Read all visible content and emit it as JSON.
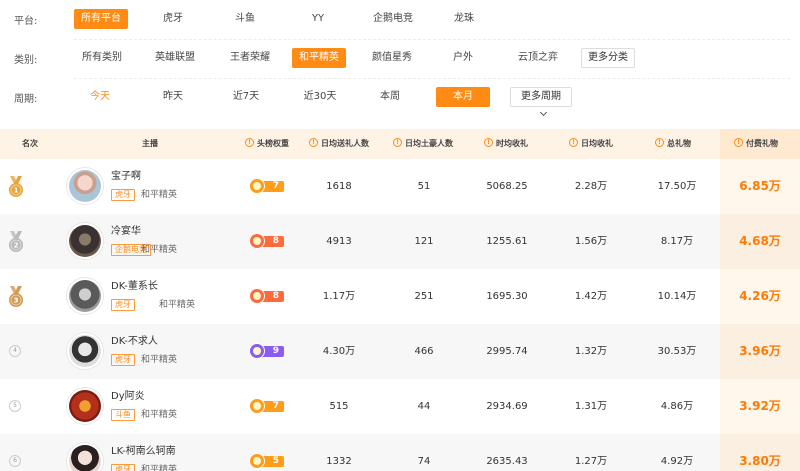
{
  "filters": {
    "platform": {
      "label": "平台:",
      "options": [
        "所有平台",
        "虎牙",
        "斗鱼",
        "YY",
        "企鹅电竞",
        "龙珠"
      ]
    },
    "category": {
      "label": "类别:",
      "options": [
        "所有类别",
        "英雄联盟",
        "王者荣耀",
        "和平精英",
        "颜值星秀",
        "户外",
        "云顶之弈"
      ],
      "more": "更多分类"
    },
    "period": {
      "label": "周期:",
      "options": [
        "今天",
        "昨天",
        "近7天",
        "近30天",
        "本周",
        "本月"
      ],
      "more": "更多周期"
    }
  },
  "table": {
    "headers": {
      "rank": "名次",
      "streamer": "主播",
      "weight": "头榜权重",
      "gifters": "日均送礼人数",
      "donors": "日均土豪人数",
      "hourly": "时均收礼",
      "daily": "日均收礼",
      "total": "总礼物",
      "paid": "付费礼物"
    },
    "rows": [
      {
        "rank": "1",
        "name": "宝子啊",
        "platform": "虎牙",
        "game": "和平精英",
        "level": "7",
        "gifters": "1618",
        "donors": "51",
        "hourly": "5068.25",
        "daily": "2.28万",
        "total": "17.50万",
        "paid": "6.85万"
      },
      {
        "rank": "2",
        "name": "冷宴华",
        "platform": "企鹅电竞",
        "game": "和平精英",
        "level": "8",
        "gifters": "4913",
        "donors": "121",
        "hourly": "1255.61",
        "daily": "1.56万",
        "total": "8.17万",
        "paid": "4.68万"
      },
      {
        "rank": "3",
        "name": "DK-董系长",
        "platform": "虎牙",
        "game": "和平精英",
        "level": "8",
        "gifters": "1.17万",
        "donors": "251",
        "hourly": "1695.30",
        "daily": "1.42万",
        "total": "10.14万",
        "paid": "4.26万"
      },
      {
        "rank": "4",
        "name": "DK-不求人",
        "platform": "虎牙",
        "game": "和平精英",
        "level": "9",
        "gifters": "4.30万",
        "donors": "466",
        "hourly": "2995.74",
        "daily": "1.32万",
        "total": "30.53万",
        "paid": "3.96万"
      },
      {
        "rank": "5",
        "name": "Dy阿炎",
        "platform": "斗鱼",
        "game": "和平精英",
        "level": "7",
        "gifters": "515",
        "donors": "44",
        "hourly": "2934.69",
        "daily": "1.31万",
        "total": "4.86万",
        "paid": "3.92万"
      },
      {
        "rank": "6",
        "name": "LK-柯南么轲南",
        "platform": "虎牙",
        "game": "和平精英",
        "level": "5",
        "gifters": "1332",
        "donors": "74",
        "hourly": "2635.43",
        "daily": "1.27万",
        "total": "4.92万",
        "paid": "3.80万"
      }
    ]
  },
  "colors": {
    "accent": "#ff8a14",
    "gold": "#e8a33a",
    "silver": "#b9b9b9",
    "bronze": "#d39a55",
    "level_orange": "#ff9c1a",
    "level_red": "#ff6a3d",
    "level_purple": "#8a5cf0"
  },
  "icons": [
    "gold-medal-icon",
    "silver-medal-icon",
    "bronze-medal-icon",
    "info-icon",
    "chevron-down-icon",
    "level-badge-icon"
  ]
}
